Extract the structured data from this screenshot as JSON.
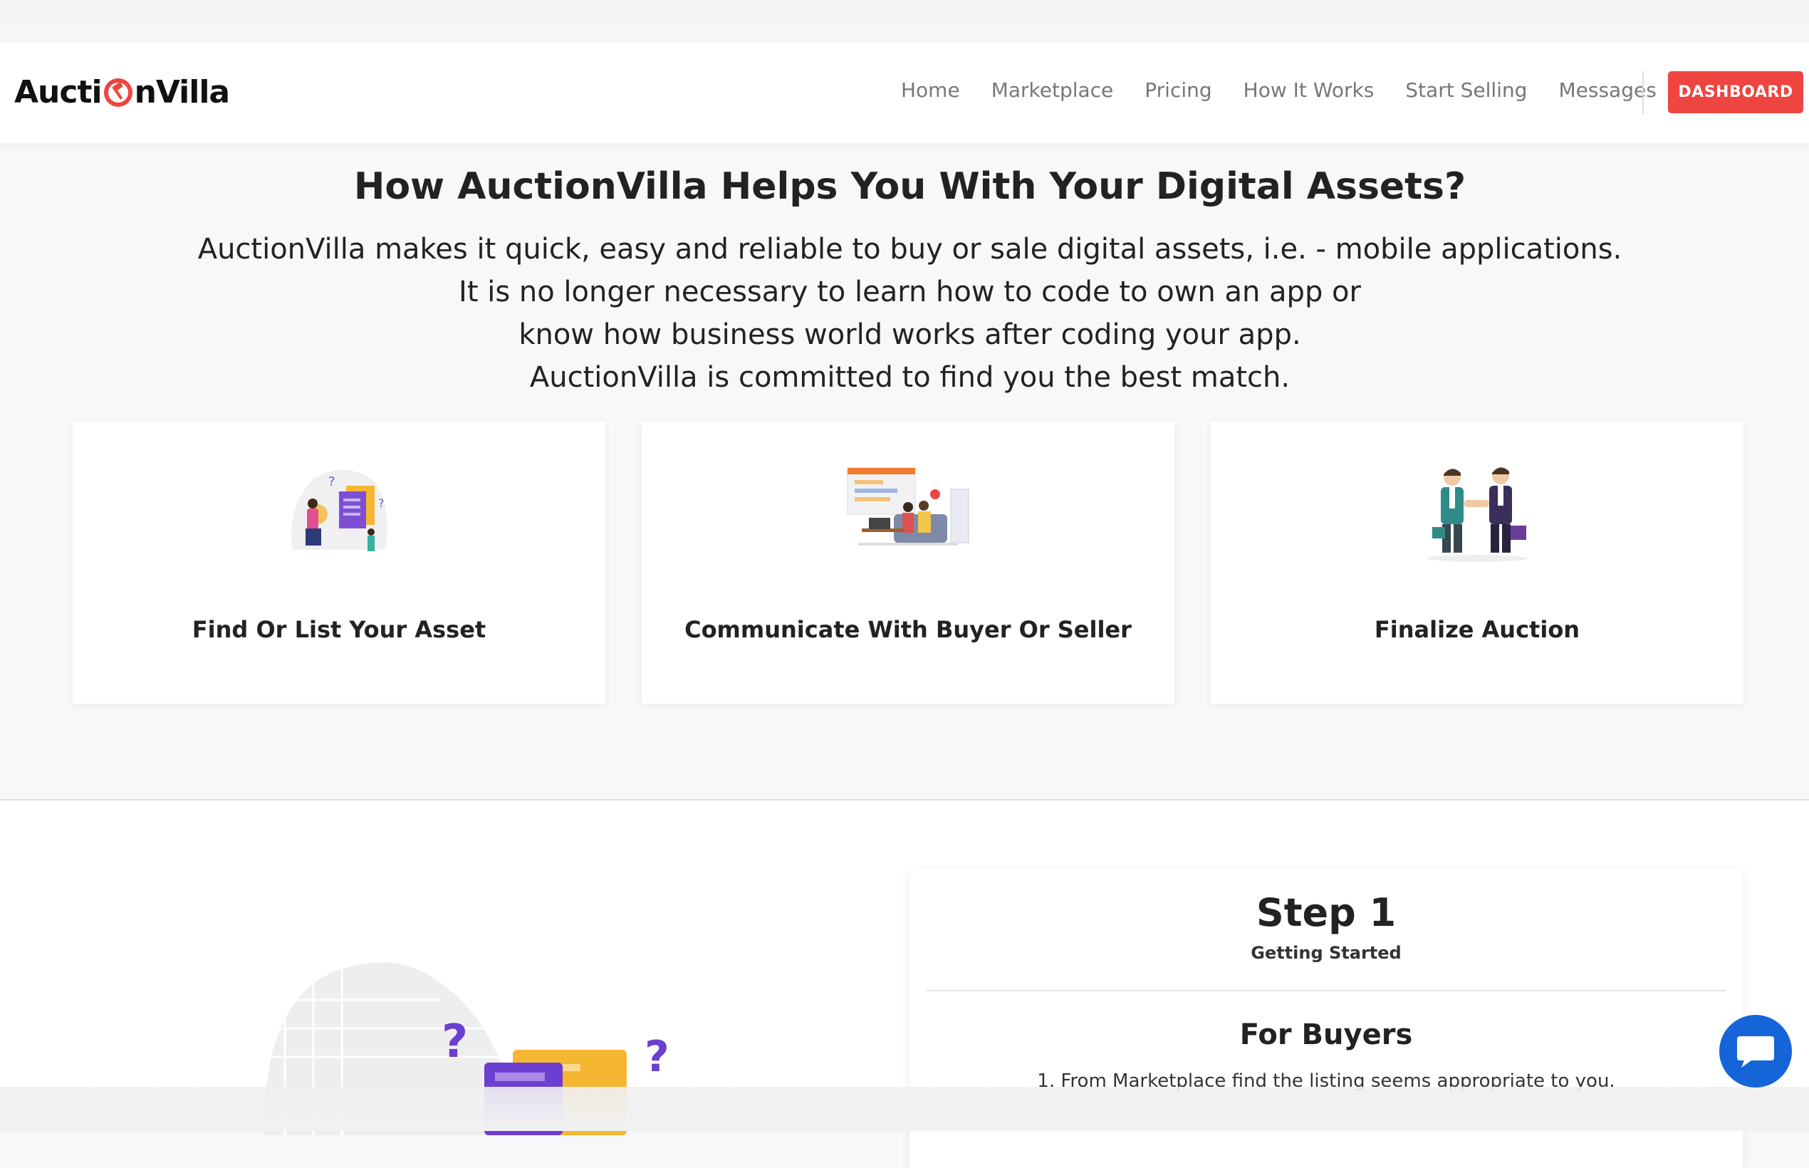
{
  "brand": {
    "logo_pre": "Aucti",
    "logo_post": "nVilla",
    "accent": "#ee4540",
    "chat_color": "#1565d8"
  },
  "nav": {
    "links": [
      "Home",
      "Marketplace",
      "Pricing",
      "How It Works",
      "Start Selling",
      "Messages"
    ],
    "dashboard": "DASHBOARD"
  },
  "hero": {
    "heading": "How AuctionVilla Helps You With Your Digital Assets?",
    "lines": [
      "AuctionVilla makes it quick, easy and reliable to buy or sale digital assets, i.e. - mobile applications.",
      "It is no longer necessary to learn how to code to own an app or",
      "know how business world works after coding your app.",
      "AuctionVilla is committed to find you the best match."
    ]
  },
  "cards": [
    {
      "title": "Find Or List Your Asset",
      "icon": "search-documents-illustration"
    },
    {
      "title": "Communicate With Buyer Or Seller",
      "icon": "chat-meeting-illustration"
    },
    {
      "title": "Finalize Auction",
      "icon": "handshake-illustration"
    }
  ],
  "step": {
    "title": "Step 1",
    "subtitle": "Getting Started",
    "section": "For Buyers",
    "item": "1. From Marketplace find the listing seems appropriate to you."
  },
  "icons": {
    "chat": "chat-bubble-icon"
  }
}
